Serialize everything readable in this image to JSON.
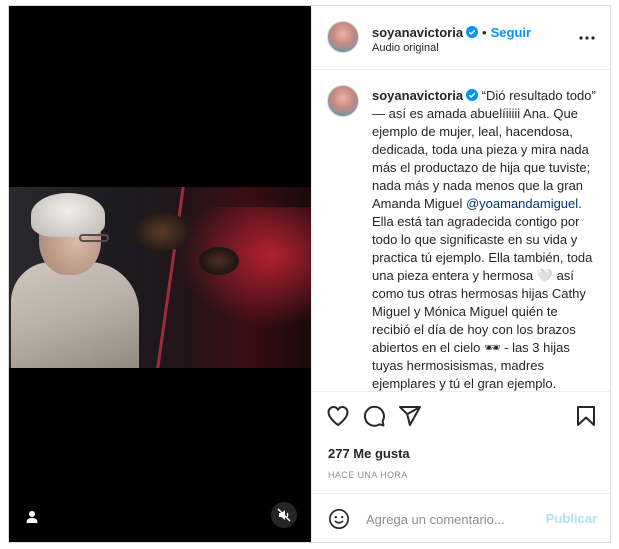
{
  "post": {
    "username": "soyanavictoria",
    "follow_label": "Seguir",
    "separator": "•",
    "audio_label": "Audio original"
  },
  "caption": {
    "username": "soyanavictoria",
    "text_before_mention": " “Dió resultado todo” — así es amada abuelíiiiii Ana. Que ejemplo de mujer, leal, hacendosa, dedicada, toda una pieza y mira nada más el productazo de hija que tuviste; nada más y nada menos que la gran Amanda Miguel ",
    "mention": "@yoamandamiguel",
    "text_after_mention": ". Ella está tan agradecida contigo por todo lo que significaste en su vida y practica tú ejemplo. Ella también, toda una pieza entera y hermosa 🤍 así como tus otras hermosas hijas Cathy Miguel y Mónica Miguel quién te recibió el día de hoy con los brazos abiertos en el cielo 🕶 - las 3 hijas tuyas hermosisismas, madres ejemplares y tú el gran ejemplo.\n\nAbuelita te voy a extrañar mucho, fui"
  },
  "stats": {
    "likes": "277 Me gusta",
    "timestamp": "HACE UNA HORA"
  },
  "comment": {
    "placeholder": "Agrega un comentario...",
    "publish_label": "Publicar"
  },
  "colors": {
    "accent": "#0095f6",
    "publish_disabled": "#b2dffc",
    "mention": "#00376b"
  },
  "icons": [
    "verified-badge-icon",
    "more-options-icon",
    "heart-icon",
    "comment-icon",
    "share-icon",
    "bookmark-icon",
    "emoji-icon",
    "person-icon",
    "mute-icon"
  ]
}
